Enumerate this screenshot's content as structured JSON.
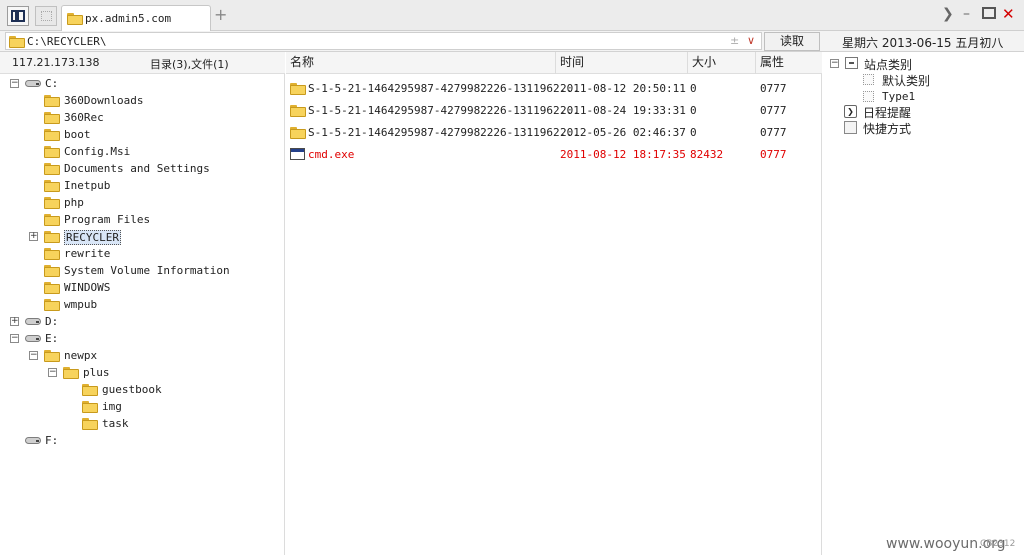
{
  "tabbar": {
    "tab_title": "px.admin5.com",
    "add_tab_glyph": "+",
    "icons": [
      "panel-toggle-icon",
      "blank-tab-icon",
      "chevron-right-icon",
      "minimize-icon",
      "maximize-icon",
      "close-icon"
    ]
  },
  "addressbar": {
    "path": "C:\\RECYCLER\\",
    "read_label": "读取",
    "datetime": "星期六 2013-06-15 五月初八"
  },
  "left_pane": {
    "ip": "117.21.173.138",
    "dir_info": "目录(3),文件(1)",
    "tree": [
      {
        "label": "C:",
        "kind": "drive",
        "level": 0,
        "expander": "minus"
      },
      {
        "label": "360Downloads",
        "kind": "folder",
        "level": 1
      },
      {
        "label": "360Rec",
        "kind": "folder",
        "level": 1
      },
      {
        "label": "boot",
        "kind": "folder",
        "level": 1
      },
      {
        "label": "Config.Msi",
        "kind": "folder",
        "level": 1
      },
      {
        "label": "Documents and Settings",
        "kind": "folder",
        "level": 1
      },
      {
        "label": "Inetpub",
        "kind": "folder",
        "level": 1
      },
      {
        "label": "php",
        "kind": "folder",
        "level": 1
      },
      {
        "label": "Program Files",
        "kind": "folder",
        "level": 1
      },
      {
        "label": "RECYCLER",
        "kind": "folder",
        "level": 1,
        "expander": "plus",
        "selected": true
      },
      {
        "label": "rewrite",
        "kind": "folder",
        "level": 1
      },
      {
        "label": "System Volume Information",
        "kind": "folder",
        "level": 1
      },
      {
        "label": "WINDOWS",
        "kind": "folder",
        "level": 1
      },
      {
        "label": "wmpub",
        "kind": "folder",
        "level": 1
      },
      {
        "label": "D:",
        "kind": "drive",
        "level": 0,
        "expander": "plus"
      },
      {
        "label": "E:",
        "kind": "drive",
        "level": 0,
        "expander": "minus"
      },
      {
        "label": "newpx",
        "kind": "folder",
        "level": 1,
        "expander": "minus"
      },
      {
        "label": "plus",
        "kind": "folder",
        "level": 2,
        "expander": "minus"
      },
      {
        "label": "guestbook",
        "kind": "folder",
        "level": 3
      },
      {
        "label": "img",
        "kind": "folder",
        "level": 3
      },
      {
        "label": "task",
        "kind": "folder",
        "level": 3
      },
      {
        "label": "F:",
        "kind": "drive",
        "level": 0
      }
    ]
  },
  "file_list": {
    "headers": {
      "name": "名称",
      "time": "时间",
      "size": "大小",
      "attr": "属性"
    },
    "rows": [
      {
        "name": "S-1-5-21-1464295987-4279982226-1311962...",
        "time": "2011-08-12 20:50:11",
        "size": "0",
        "attr": "0777",
        "kind": "folder"
      },
      {
        "name": "S-1-5-21-1464295987-4279982226-1311962...",
        "time": "2011-08-24 19:33:31",
        "size": "0",
        "attr": "0777",
        "kind": "folder"
      },
      {
        "name": "S-1-5-21-1464295987-4279982226-1311962...",
        "time": "2012-05-26 02:46:37",
        "size": "0",
        "attr": "0777",
        "kind": "folder"
      },
      {
        "name": "cmd.exe",
        "time": "2011-08-12 18:17:35",
        "size": "82432",
        "attr": "0777",
        "kind": "exe",
        "highlight": "#e00000"
      }
    ]
  },
  "right_pane": {
    "site_category": "站点类别",
    "default_category": "默认类别",
    "type1": "Type1",
    "schedule": "日程提醒",
    "shortcuts": "快捷方式"
  },
  "footer": {
    "watermark": "www.wooyun.org",
    "code": "CB2312"
  }
}
